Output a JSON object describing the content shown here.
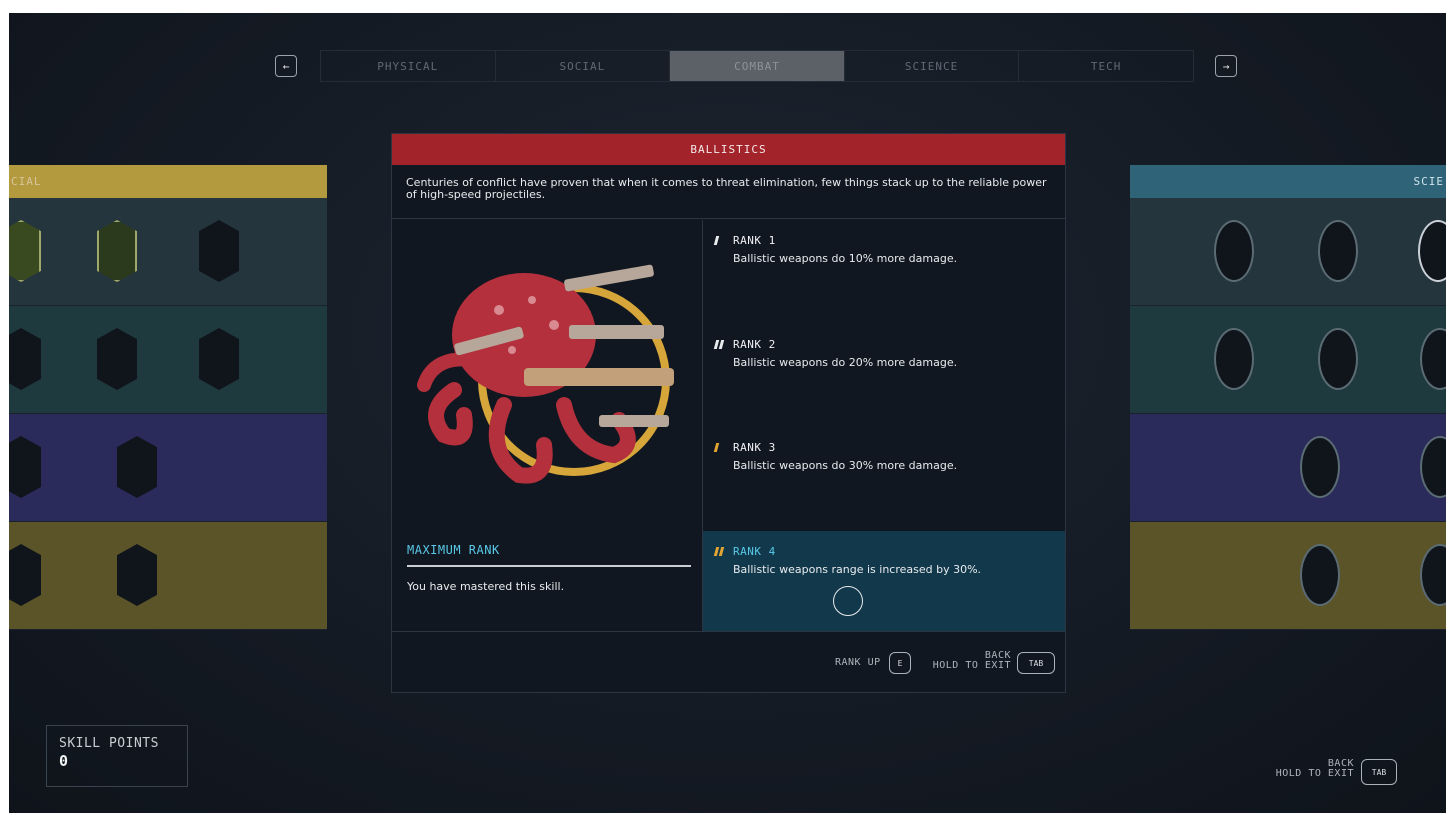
{
  "tabs": {
    "prev_label": "←",
    "next_label": "→",
    "items": [
      {
        "label": "PHYSICAL"
      },
      {
        "label": "SOCIAL"
      },
      {
        "label": "COMBAT"
      },
      {
        "label": "SCIENCE"
      },
      {
        "label": "TECH"
      }
    ],
    "active_index": 2
  },
  "left_panel": {
    "header": "CIAL"
  },
  "right_panel": {
    "header": "SCIE"
  },
  "modal": {
    "title": "BALLISTICS",
    "description": "Centuries of conflict have proven that when it comes to threat elimination, few things stack up to the reliable power of high-speed projectiles.",
    "max_rank_title": "MAXIMUM RANK",
    "max_rank_desc": "You have mastered this skill.",
    "ranks": [
      {
        "title": "RANK 1",
        "desc": "Ballistic weapons do 10% more damage."
      },
      {
        "title": "RANK 2",
        "desc": "Ballistic weapons do 20% more damage."
      },
      {
        "title": "RANK 3",
        "desc": "Ballistic weapons do 30% more damage."
      },
      {
        "title": "RANK 4",
        "desc": "Ballistic weapons range is increased by 30%."
      }
    ],
    "footer": {
      "rank_up_label": "RANK UP",
      "rank_up_key": "E",
      "back_label": "BACK",
      "hold_exit_label": "HOLD TO EXIT",
      "back_key": "TAB"
    }
  },
  "skill_points": {
    "label": "SKILL POINTS",
    "value": "0"
  },
  "bottom_right": {
    "back_label": "BACK",
    "hold_exit_label": "HOLD TO EXIT",
    "key": "TAB"
  },
  "colors": {
    "title_bar": "#a3232b",
    "accent_cyan": "#58c9e8",
    "rank_gold": "#e2a532",
    "active_rank_bg": "#12384b"
  }
}
